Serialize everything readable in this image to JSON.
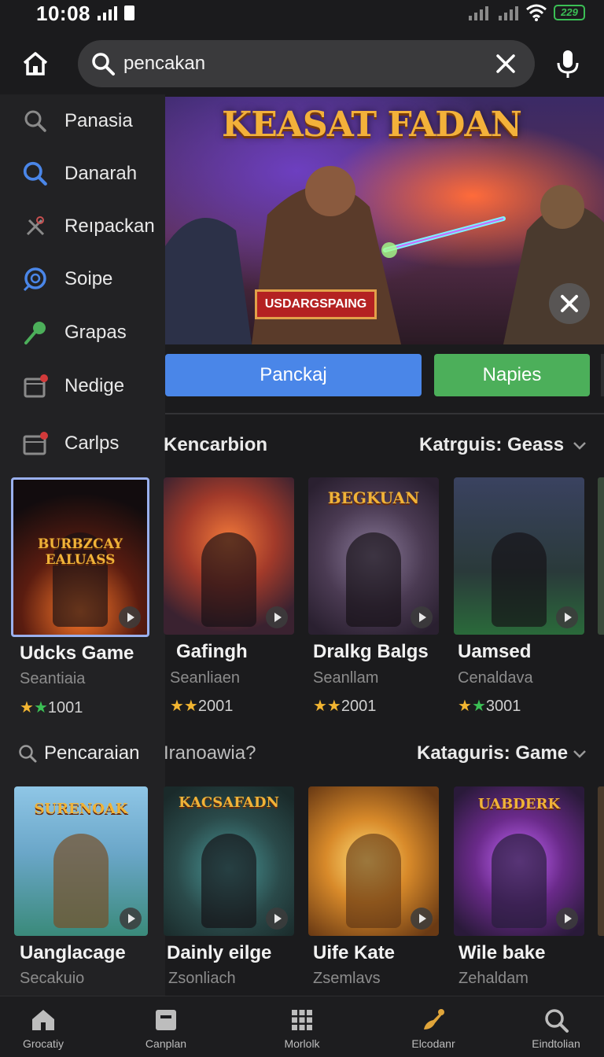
{
  "status_bar": {
    "time": "10:08",
    "battery": "229"
  },
  "header": {
    "search_value": "pencakan"
  },
  "sidebar": {
    "items": [
      {
        "label": "Panasia",
        "icon": "search-icon"
      },
      {
        "label": "Danarah",
        "icon": "search-icon"
      },
      {
        "label": "Reıpackan",
        "icon": "tools-icon"
      },
      {
        "label": "Soipe",
        "icon": "compass-icon"
      },
      {
        "label": "Grapas",
        "icon": "pin-icon"
      },
      {
        "label": "Nedige",
        "icon": "calendar-badge-icon"
      },
      {
        "label": "Carlps",
        "icon": "calendar-badge-icon"
      }
    ]
  },
  "banner": {
    "title": "KEASAT FADAN",
    "ribbon": "USDARGSPAING"
  },
  "actions": {
    "primary": "Panckaj",
    "secondary": "Napies"
  },
  "section1": {
    "title": "Kencarbion",
    "filter": "Katrguis: Geass",
    "cards": [
      {
        "tag": "BURBZCAY EALUASS",
        "name": "Udcks Game",
        "sub": "Seantiaia",
        "rating": "1001"
      },
      {
        "tag": "",
        "name": "Gafingh",
        "sub": "Seanliaen",
        "rating": "2001"
      },
      {
        "tag": "BEGKUAN",
        "name": "Dralkg Balgs",
        "sub": "Seanllam",
        "rating": "2001"
      },
      {
        "tag": "",
        "name": "Uamsed",
        "sub": "Cenaldava",
        "rating": "3001"
      }
    ]
  },
  "section2": {
    "title": "Pencaraian",
    "title2": "Iranoawia?",
    "filter": "Kataguris: Game",
    "cards": [
      {
        "tag": "SURENOAK",
        "name": "Uanglacage",
        "sub": "Secakuio"
      },
      {
        "tag": "KACSAFADN",
        "name": "Dainly eilge",
        "sub": "Zsonliach"
      },
      {
        "tag": "",
        "name": "Uife Kate",
        "sub": "Zsemlavs"
      },
      {
        "tag": "UABDERK",
        "name": "Wile bake",
        "sub": "Zehaldam"
      }
    ]
  },
  "bottom_nav": [
    {
      "label": "Grocatiy",
      "icon": "home-icon"
    },
    {
      "label": "Canplan",
      "icon": "inbox-icon"
    },
    {
      "label": "Morlolk",
      "icon": "grid-icon"
    },
    {
      "label": "Elcodanr",
      "icon": "brush-icon"
    },
    {
      "label": "Eindtolian",
      "icon": "search-icon"
    }
  ]
}
